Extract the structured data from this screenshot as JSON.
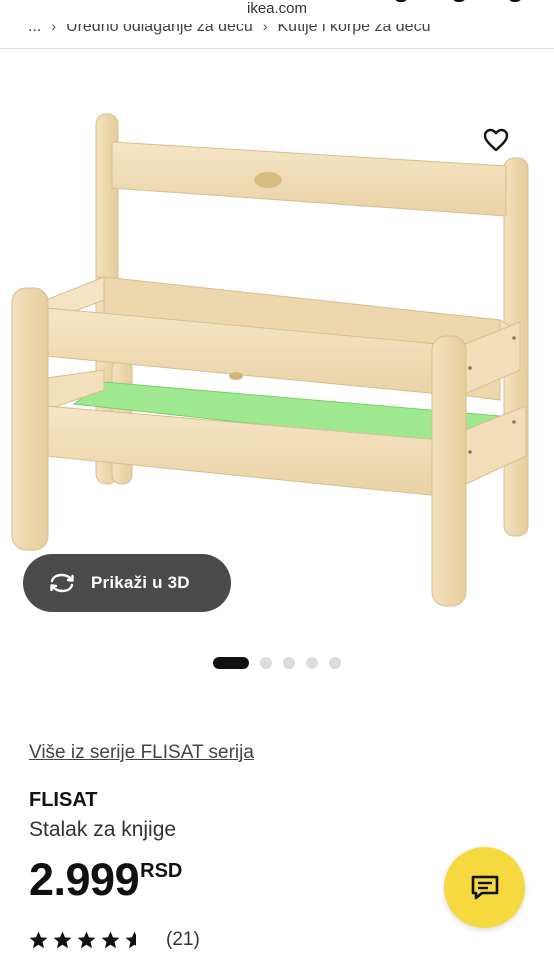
{
  "browser": {
    "url": "ikea.com"
  },
  "breadcrumb": {
    "items": [
      "...",
      "Uredno odlaganje za decu",
      "Kutije i korpe za decu"
    ]
  },
  "product_image": {
    "alt_icon": "bookshelf-product-image",
    "accent": "#9ee88f"
  },
  "favorite": {
    "icon": "heart-icon"
  },
  "view3d": {
    "label": "Prikaži u 3D",
    "icon": "rotate-3d-icon"
  },
  "carousel": {
    "total": 5,
    "active": 1
  },
  "product": {
    "series_link": "Više iz serije FLISAT serija",
    "name": "FLISAT",
    "description": "Stalak za knjige",
    "price": "2.999",
    "currency": "RSD",
    "rating": 4.5,
    "review_count": "(21)"
  },
  "chat": {
    "icon": "chat-icon",
    "color": "#f6d93f"
  }
}
